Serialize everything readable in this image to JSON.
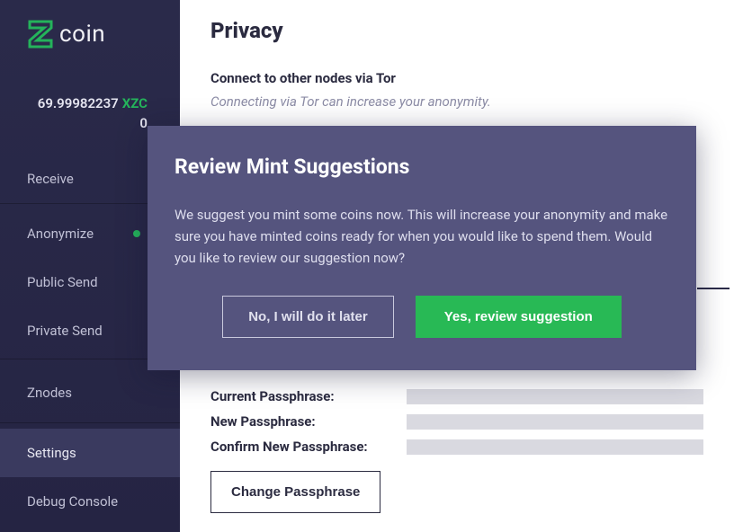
{
  "brand": {
    "name": "coin"
  },
  "balance": {
    "amount": "69.99982237",
    "ticker": "XZC",
    "sub": "0"
  },
  "nav": {
    "receive": "Receive",
    "anonymize": "Anonymize",
    "public_send": "Public Send",
    "private_send": "Private Send",
    "znodes": "Znodes",
    "settings": "Settings",
    "debug_console": "Debug Console"
  },
  "page": {
    "title": "Privacy",
    "tor_heading": "Connect to other nodes via Tor",
    "tor_desc": "Connecting via Tor can increase your anonymity."
  },
  "passphrase": {
    "current_label": "Current Passphrase:",
    "new_label": "New Passphrase:",
    "confirm_label": "Confirm New Passphrase:",
    "change_button": "Change Passphrase"
  },
  "modal": {
    "title": "Review Mint Suggestions",
    "body": "We suggest you mint some coins now. This will increase your anonymity and make sure you have minted coins ready for when you would like to spend them. Would you like to review our suggestion now?",
    "secondary": "No, I will do it later",
    "primary": "Yes, review suggestion"
  }
}
